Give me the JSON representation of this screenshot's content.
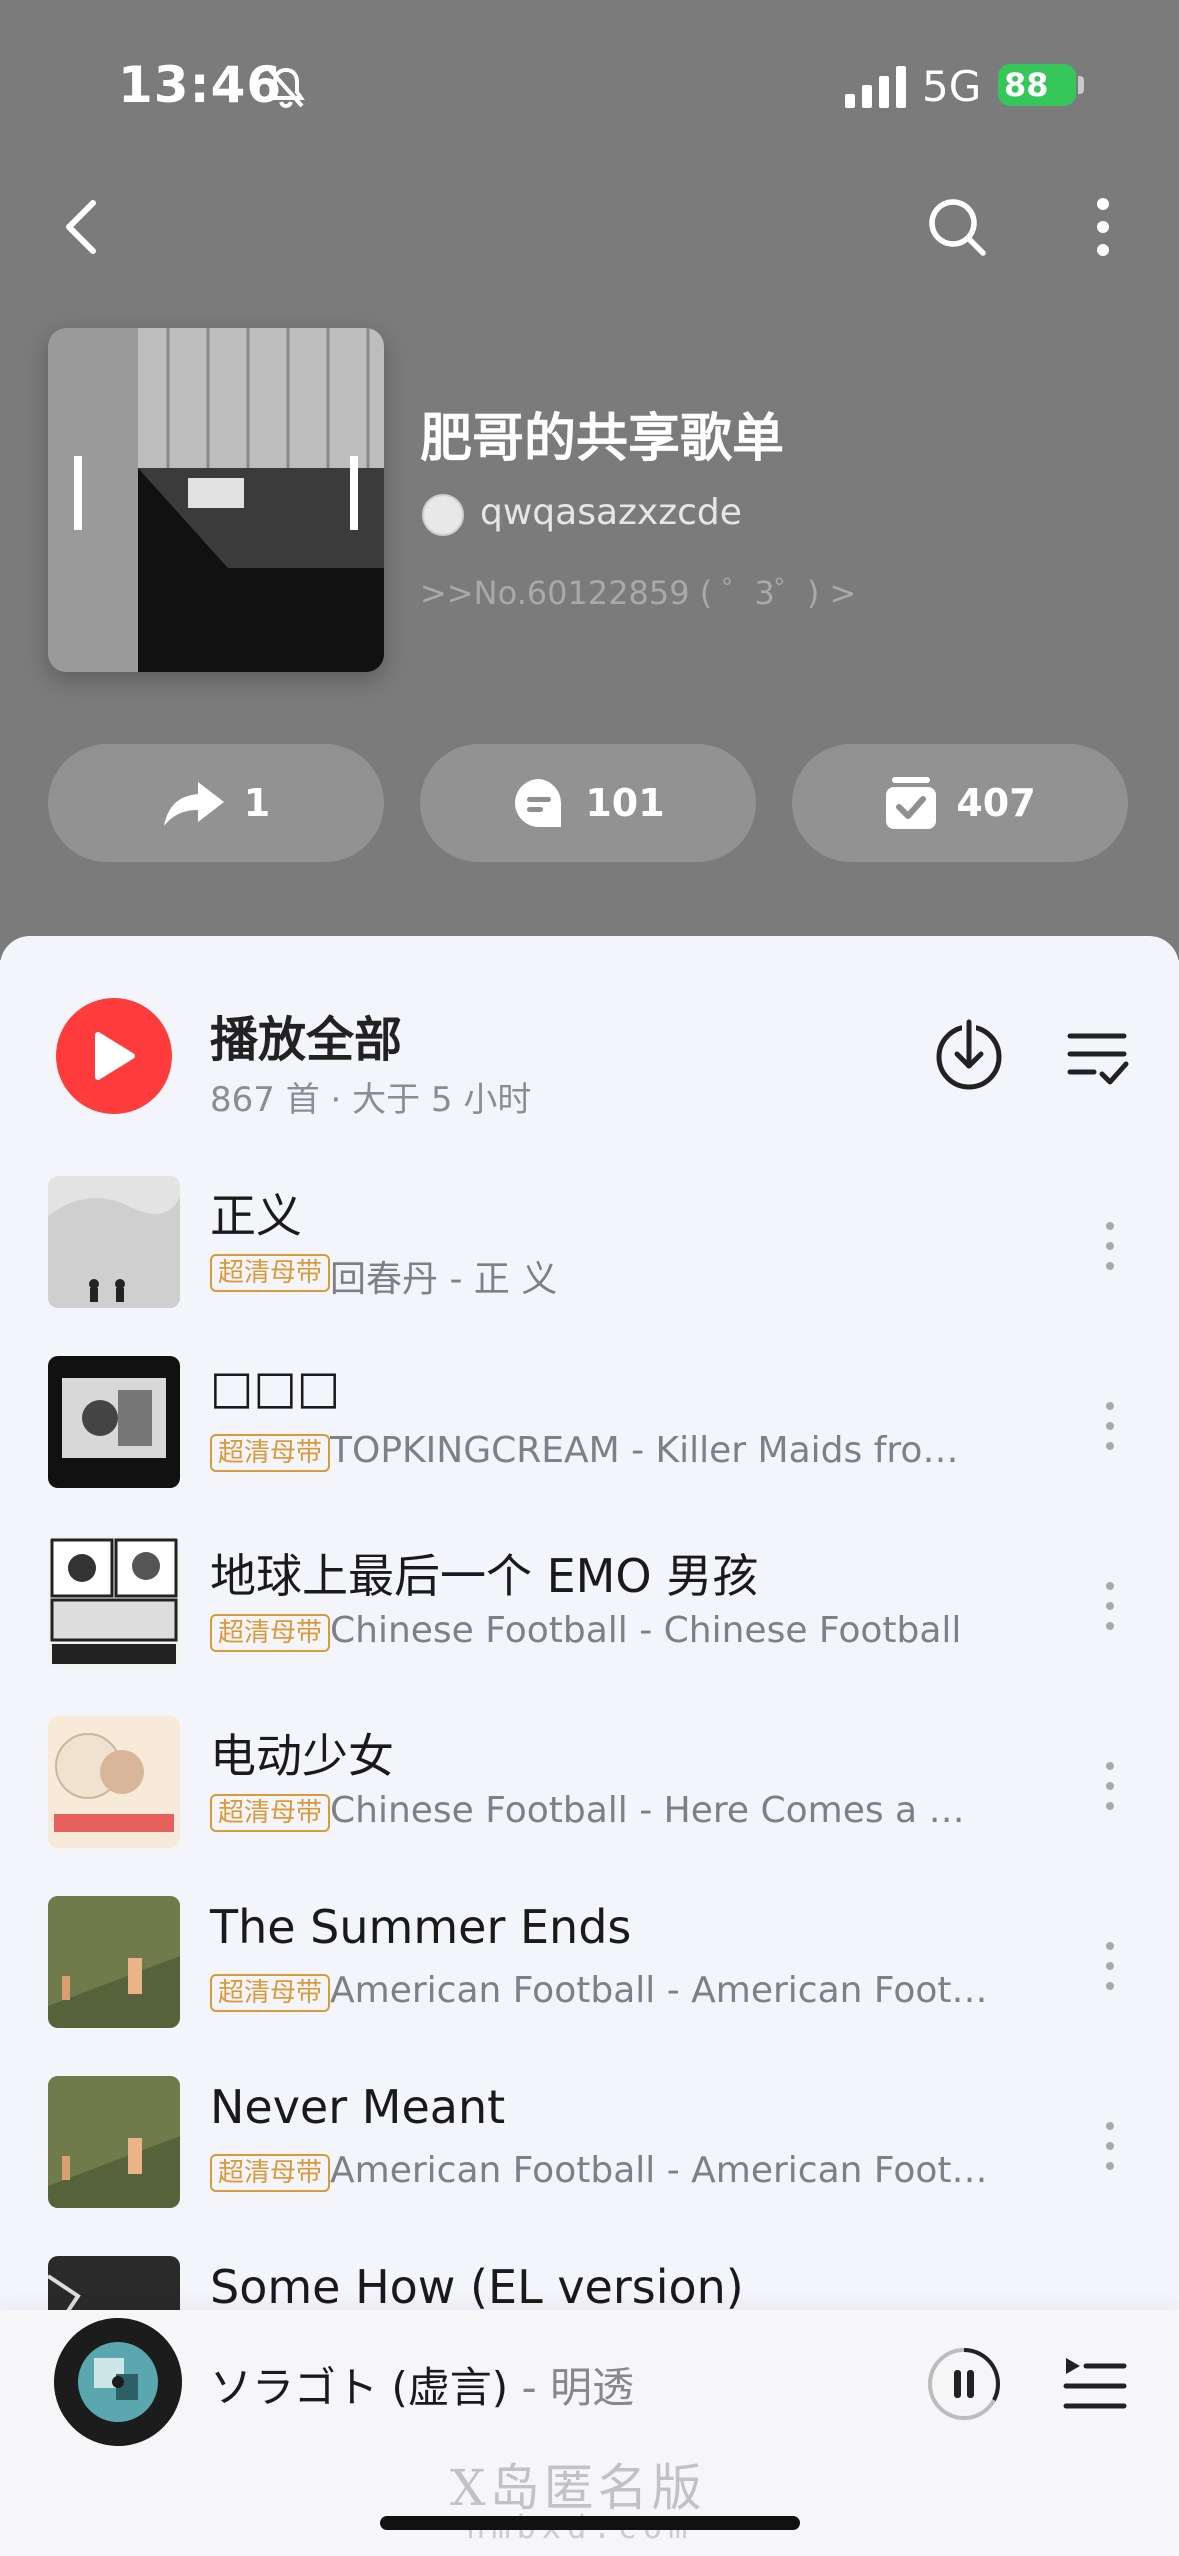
{
  "status_bar": {
    "time": "13:46",
    "network": "5G",
    "battery": "88"
  },
  "playlist": {
    "title": "肥哥的共享歌单",
    "owner": "qwqasazxzcde",
    "description": ">>No.60122859 ( ゜3゜) >"
  },
  "actions": {
    "share_count": "1",
    "comment_count": "101",
    "collect_count": "407"
  },
  "play_all": {
    "label": "播放全部",
    "subtitle": "867 首 · 大于 5 小时"
  },
  "songs": [
    {
      "title": "正义",
      "badge": "超清母带",
      "meta": "回春丹 - 正 义"
    },
    {
      "title": "□□□",
      "badge": "超清母带",
      "meta": "TOPKINGCREAM - Killer Maids from..."
    },
    {
      "title": "地球上最后一个 EMO 男孩",
      "badge": "超清母带",
      "meta": "Chinese Football - Chinese Football"
    },
    {
      "title": "电动少女",
      "badge": "超清母带",
      "meta": "Chinese Football - Here Comes a Ne..."
    },
    {
      "title": "The Summer Ends",
      "badge": "超清母带",
      "meta": "American Football - American Footb..."
    },
    {
      "title": "Never Meant",
      "badge": "超清母带",
      "meta": "American Football - American Footb..."
    },
    {
      "title": "Some How (EL version)",
      "badge": "",
      "meta": ""
    }
  ],
  "player": {
    "title": "ソラゴト (虚言)",
    "artist": "- 明透"
  },
  "watermark": {
    "line1": "X岛匿名版",
    "line2": "nmbxd.com"
  },
  "colors": {
    "accent": "#ff3b3b",
    "badge": "#d99a3a",
    "header_bg": "#7b7b7b",
    "battery": "#35c759"
  }
}
